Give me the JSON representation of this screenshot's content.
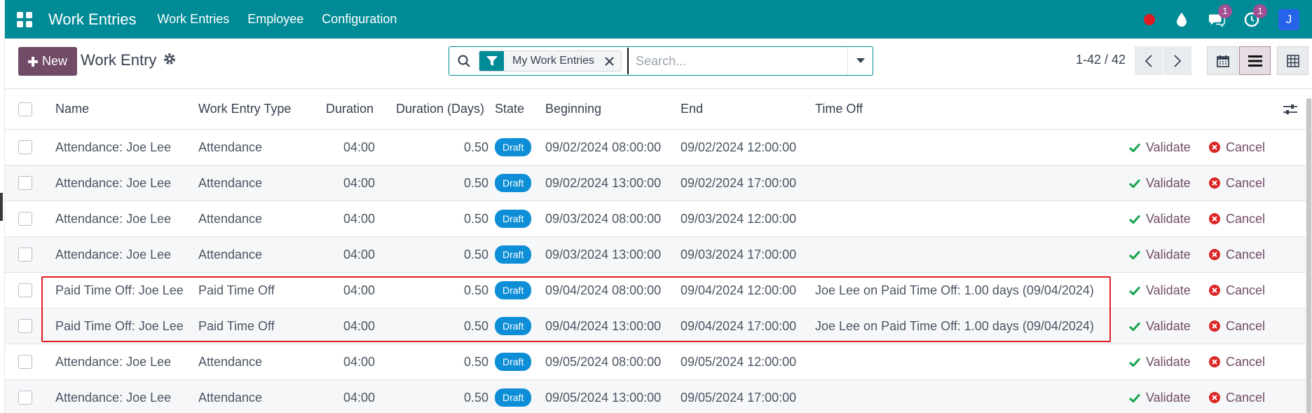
{
  "navbar": {
    "brand": "Work Entries",
    "menu": [
      "Work Entries",
      "Employee",
      "Configuration"
    ],
    "messages_count": "1",
    "activities_count": "1",
    "avatar_initial": "J",
    "colors": {
      "bar": "#018b96",
      "badge": "#a34f93",
      "avatar": "#2563eb"
    }
  },
  "control": {
    "new_label": "New",
    "title": "Work Entry",
    "facet_label": "My Work Entries",
    "search_placeholder": "Search...",
    "pager": "1-42 / 42"
  },
  "table": {
    "columns": [
      "Name",
      "Work Entry Type",
      "Duration",
      "Duration (Days)",
      "State",
      "Beginning",
      "End",
      "Time Off"
    ],
    "validate_label": "Validate",
    "cancel_label": "Cancel",
    "rows": [
      {
        "name": "Attendance: Joe Lee",
        "type": "Attendance",
        "duration": "04:00",
        "days": "0.50",
        "state": "Draft",
        "beginning": "09/02/2024 08:00:00",
        "end": "09/02/2024 12:00:00",
        "time_off": ""
      },
      {
        "name": "Attendance: Joe Lee",
        "type": "Attendance",
        "duration": "04:00",
        "days": "0.50",
        "state": "Draft",
        "beginning": "09/02/2024 13:00:00",
        "end": "09/02/2024 17:00:00",
        "time_off": ""
      },
      {
        "name": "Attendance: Joe Lee",
        "type": "Attendance",
        "duration": "04:00",
        "days": "0.50",
        "state": "Draft",
        "beginning": "09/03/2024 08:00:00",
        "end": "09/03/2024 12:00:00",
        "time_off": ""
      },
      {
        "name": "Attendance: Joe Lee",
        "type": "Attendance",
        "duration": "04:00",
        "days": "0.50",
        "state": "Draft",
        "beginning": "09/03/2024 13:00:00",
        "end": "09/03/2024 17:00:00",
        "time_off": ""
      },
      {
        "name": "Paid Time Off: Joe Lee",
        "type": "Paid Time Off",
        "duration": "04:00",
        "days": "0.50",
        "state": "Draft",
        "beginning": "09/04/2024 08:00:00",
        "end": "09/04/2024 12:00:00",
        "time_off": "Joe Lee on Paid Time Off: 1.00 days (09/04/2024)"
      },
      {
        "name": "Paid Time Off: Joe Lee",
        "type": "Paid Time Off",
        "duration": "04:00",
        "days": "0.50",
        "state": "Draft",
        "beginning": "09/04/2024 13:00:00",
        "end": "09/04/2024 17:00:00",
        "time_off": "Joe Lee on Paid Time Off: 1.00 days (09/04/2024)"
      },
      {
        "name": "Attendance: Joe Lee",
        "type": "Attendance",
        "duration": "04:00",
        "days": "0.50",
        "state": "Draft",
        "beginning": "09/05/2024 08:00:00",
        "end": "09/05/2024 12:00:00",
        "time_off": ""
      },
      {
        "name": "Attendance: Joe Lee",
        "type": "Attendance",
        "duration": "04:00",
        "days": "0.50",
        "state": "Draft",
        "beginning": "09/05/2024 13:00:00",
        "end": "09/05/2024 17:00:00",
        "time_off": ""
      }
    ]
  }
}
